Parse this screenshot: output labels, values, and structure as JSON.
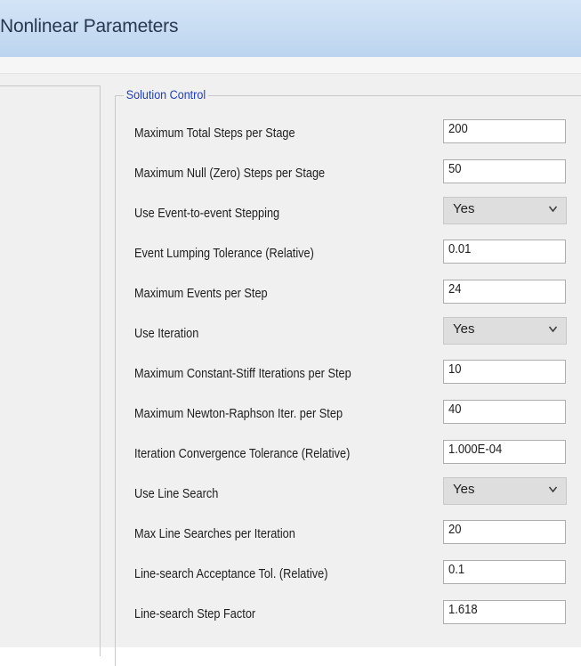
{
  "window": {
    "title": "Nonlinear Parameters"
  },
  "group": {
    "title": "Solution Control"
  },
  "rows": [
    {
      "label": "Maximum Total Steps per Stage",
      "type": "text",
      "value": "200"
    },
    {
      "label": "Maximum Null (Zero) Steps per Stage",
      "type": "text",
      "value": "50"
    },
    {
      "label": "Use Event-to-event Stepping",
      "type": "select",
      "value": "Yes"
    },
    {
      "label": "Event Lumping Tolerance (Relative)",
      "type": "text",
      "value": "0.01"
    },
    {
      "label": "Maximum Events per Step",
      "type": "text",
      "value": "24"
    },
    {
      "label": "Use Iteration",
      "type": "select",
      "value": "Yes"
    },
    {
      "label": "Maximum Constant-Stiff Iterations per Step",
      "type": "text",
      "value": "10"
    },
    {
      "label": "Maximum Newton-Raphson Iter. per Step",
      "type": "text",
      "value": "40"
    },
    {
      "label": "Iteration Convergence Tolerance (Relative)",
      "type": "text",
      "value": "1.000E-04"
    },
    {
      "label": "Use Line Search",
      "type": "select",
      "value": "Yes"
    },
    {
      "label": "Max Line Searches per Iteration",
      "type": "text",
      "value": "20"
    },
    {
      "label": "Line-search Acceptance Tol. (Relative)",
      "type": "text",
      "value": "0.1"
    },
    {
      "label": "Line-search Step Factor",
      "type": "text",
      "value": "1.618"
    }
  ],
  "icons": {
    "dropdown": "chevron-down-icon"
  },
  "colors": {
    "title_bar": "#c7dcf2",
    "group_title": "#1f3fb3",
    "panel_background": "#f0f0f0",
    "dropdown_background": "#dedede"
  }
}
